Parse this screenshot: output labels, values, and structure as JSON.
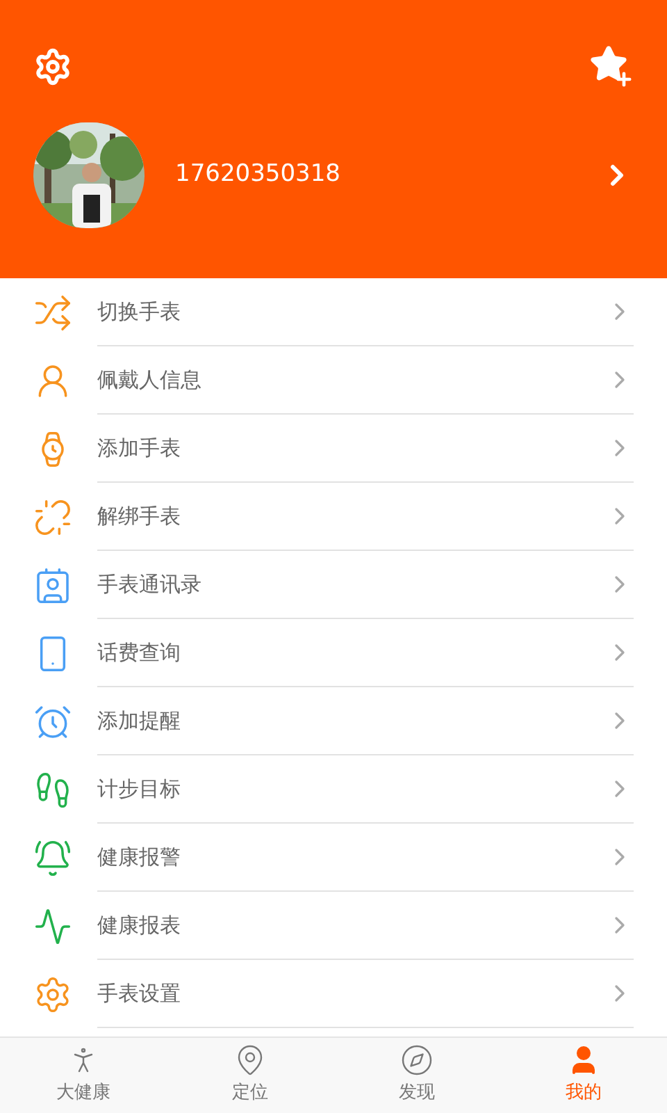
{
  "header": {
    "phone": "17620350318"
  },
  "menu": [
    {
      "label": "切换手表",
      "color": "#f7931e"
    },
    {
      "label": "佩戴人信息",
      "color": "#f7931e"
    },
    {
      "label": "添加手表",
      "color": "#f7931e"
    },
    {
      "label": "解绑手表",
      "color": "#f7931e"
    },
    {
      "label": "手表通讯录",
      "color": "#4a9ff5"
    },
    {
      "label": "话费查询",
      "color": "#4a9ff5"
    },
    {
      "label": "添加提醒",
      "color": "#4a9ff5"
    },
    {
      "label": "计步目标",
      "color": "#22b14c"
    },
    {
      "label": "健康报警",
      "color": "#22b14c"
    },
    {
      "label": "健康报表",
      "color": "#22b14c"
    },
    {
      "label": "手表设置",
      "color": "#f7931e"
    }
  ],
  "tabs": [
    {
      "label": "大健康",
      "selected": false
    },
    {
      "label": "定位",
      "selected": false
    },
    {
      "label": "发现",
      "selected": false
    },
    {
      "label": "我的",
      "selected": true
    }
  ]
}
